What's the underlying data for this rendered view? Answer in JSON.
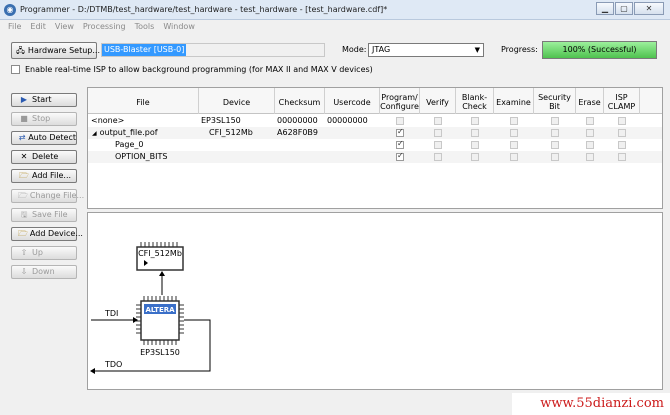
{
  "window": {
    "title": "Programmer - D:/DTMB/test_hardware/test_hardware - test_hardware - [test_hardware.cdf]*",
    "min": "▁",
    "max": "▢",
    "close": "✕"
  },
  "menu": [
    "File",
    "Edit",
    "View",
    "Processing",
    "Tools",
    "Window"
  ],
  "setup": {
    "hardware_button": "Hardware Setup...",
    "hardware_value": "USB-Blaster [USB-0]",
    "mode_label": "Mode:",
    "mode_value": "JTAG",
    "progress_label": "Progress:",
    "progress_text": "100% (Successful)",
    "progress_value": 100,
    "isp_label": "Enable real-time ISP to allow background programming (for MAX II and MAX V devices)"
  },
  "buttons": {
    "start": "Start",
    "stop": "Stop",
    "auto_detect": "Auto Detect",
    "delete": "Delete",
    "add_file": "Add File...",
    "change_file": "Change File...",
    "save_file": "Save File",
    "add_device": "Add Device...",
    "up": "Up",
    "down": "Down"
  },
  "table": {
    "columns": {
      "file": "File",
      "device": "Device",
      "checksum": "Checksum",
      "usercode": "Usercode",
      "program1": "Program/",
      "program2": "Configure",
      "verify": "Verify",
      "blank1": "Blank-",
      "blank2": "Check",
      "examine": "Examine",
      "security1": "Security",
      "security2": "Bit",
      "erase": "Erase",
      "isp1": "ISP",
      "isp2": "CLAMP"
    },
    "rows": [
      {
        "file": "<none>",
        "device": "EP3SL150",
        "checksum": "00000000",
        "usercode": "00000000",
        "program": false
      },
      {
        "file": "output_file.pof",
        "device": "CFI_512Mb",
        "checksum": "A628F0B9",
        "usercode": "",
        "program": true
      },
      {
        "file": "Page_0",
        "device": "",
        "checksum": "",
        "usercode": "",
        "program": true
      },
      {
        "file": "OPTION_BITS",
        "device": "",
        "checksum": "",
        "usercode": "",
        "program": true
      }
    ]
  },
  "diagram": {
    "flash_label": "CFI_512Mb",
    "fpga_label": "EP3SL150",
    "fpga_logo": "ALTERA",
    "tdi": "TDI",
    "tdo": "TDO"
  },
  "watermark": "www.55dianzi.com",
  "colors": {
    "progress_fill": "#5cc95c",
    "selection": "#3399ff",
    "watermark": "#cc1b1b"
  }
}
